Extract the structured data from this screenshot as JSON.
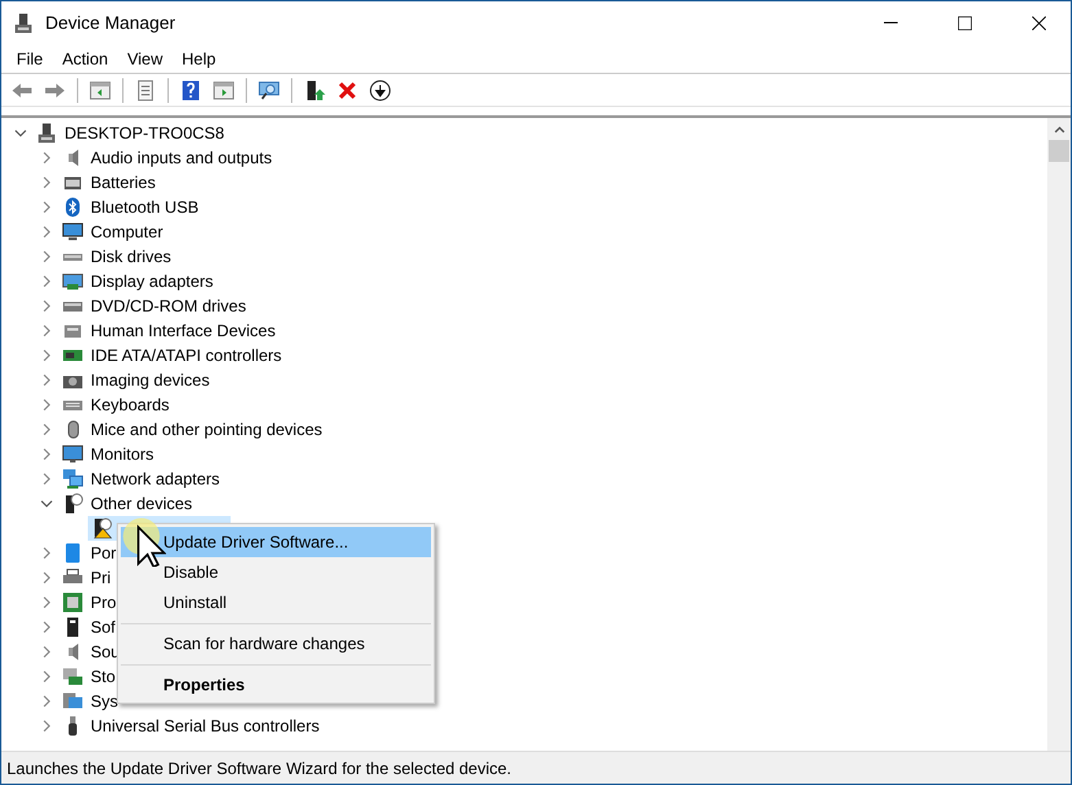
{
  "window": {
    "title": "Device Manager"
  },
  "menu_bar": [
    "File",
    "Action",
    "View",
    "Help"
  ],
  "tree": {
    "label": "DESKTOP-TRO0CS8",
    "expanded": true,
    "children": [
      {
        "label": "Audio inputs and outputs",
        "expanded": false
      },
      {
        "label": "Batteries",
        "expanded": false
      },
      {
        "label": "Bluetooth USB",
        "expanded": false
      },
      {
        "label": "Computer",
        "expanded": false
      },
      {
        "label": "Disk drives",
        "expanded": false
      },
      {
        "label": "Display adapters",
        "expanded": false
      },
      {
        "label": "DVD/CD-ROM drives",
        "expanded": false
      },
      {
        "label": "Human Interface Devices",
        "expanded": false
      },
      {
        "label": "IDE ATA/ATAPI controllers",
        "expanded": false
      },
      {
        "label": "Imaging devices",
        "expanded": false
      },
      {
        "label": "Keyboards",
        "expanded": false
      },
      {
        "label": "Mice and other pointing devices",
        "expanded": false
      },
      {
        "label": "Monitors",
        "expanded": false
      },
      {
        "label": "Network adapters",
        "expanded": false
      },
      {
        "label": "Other devices",
        "expanded": true,
        "children": [
          {
            "selected": true,
            "warning": true
          }
        ]
      },
      {
        "label": "Por",
        "expanded": false
      },
      {
        "label": "Pri",
        "expanded": false
      },
      {
        "label": "Pro",
        "expanded": false
      },
      {
        "label": "Sof",
        "expanded": false
      },
      {
        "label": "Sou",
        "expanded": false
      },
      {
        "label": "Sto",
        "expanded": false
      },
      {
        "label": "Sys",
        "expanded": false
      },
      {
        "label": "Universal Serial Bus controllers",
        "expanded": false
      }
    ]
  },
  "context_menu": [
    {
      "label": "Update Driver Software...",
      "selected": true,
      "separator_before": false,
      "default": false
    },
    {
      "label": "Disable",
      "selected": false,
      "separator_before": false,
      "default": false
    },
    {
      "label": "Uninstall",
      "selected": false,
      "separator_before": false,
      "default": false
    },
    {
      "label": "Scan for hardware changes",
      "selected": false,
      "separator_before": true,
      "default": false
    },
    {
      "label": "Properties",
      "selected": false,
      "separator_before": true,
      "default": true
    }
  ],
  "status_bar": "Launches the Update Driver Software Wizard for the selected device."
}
